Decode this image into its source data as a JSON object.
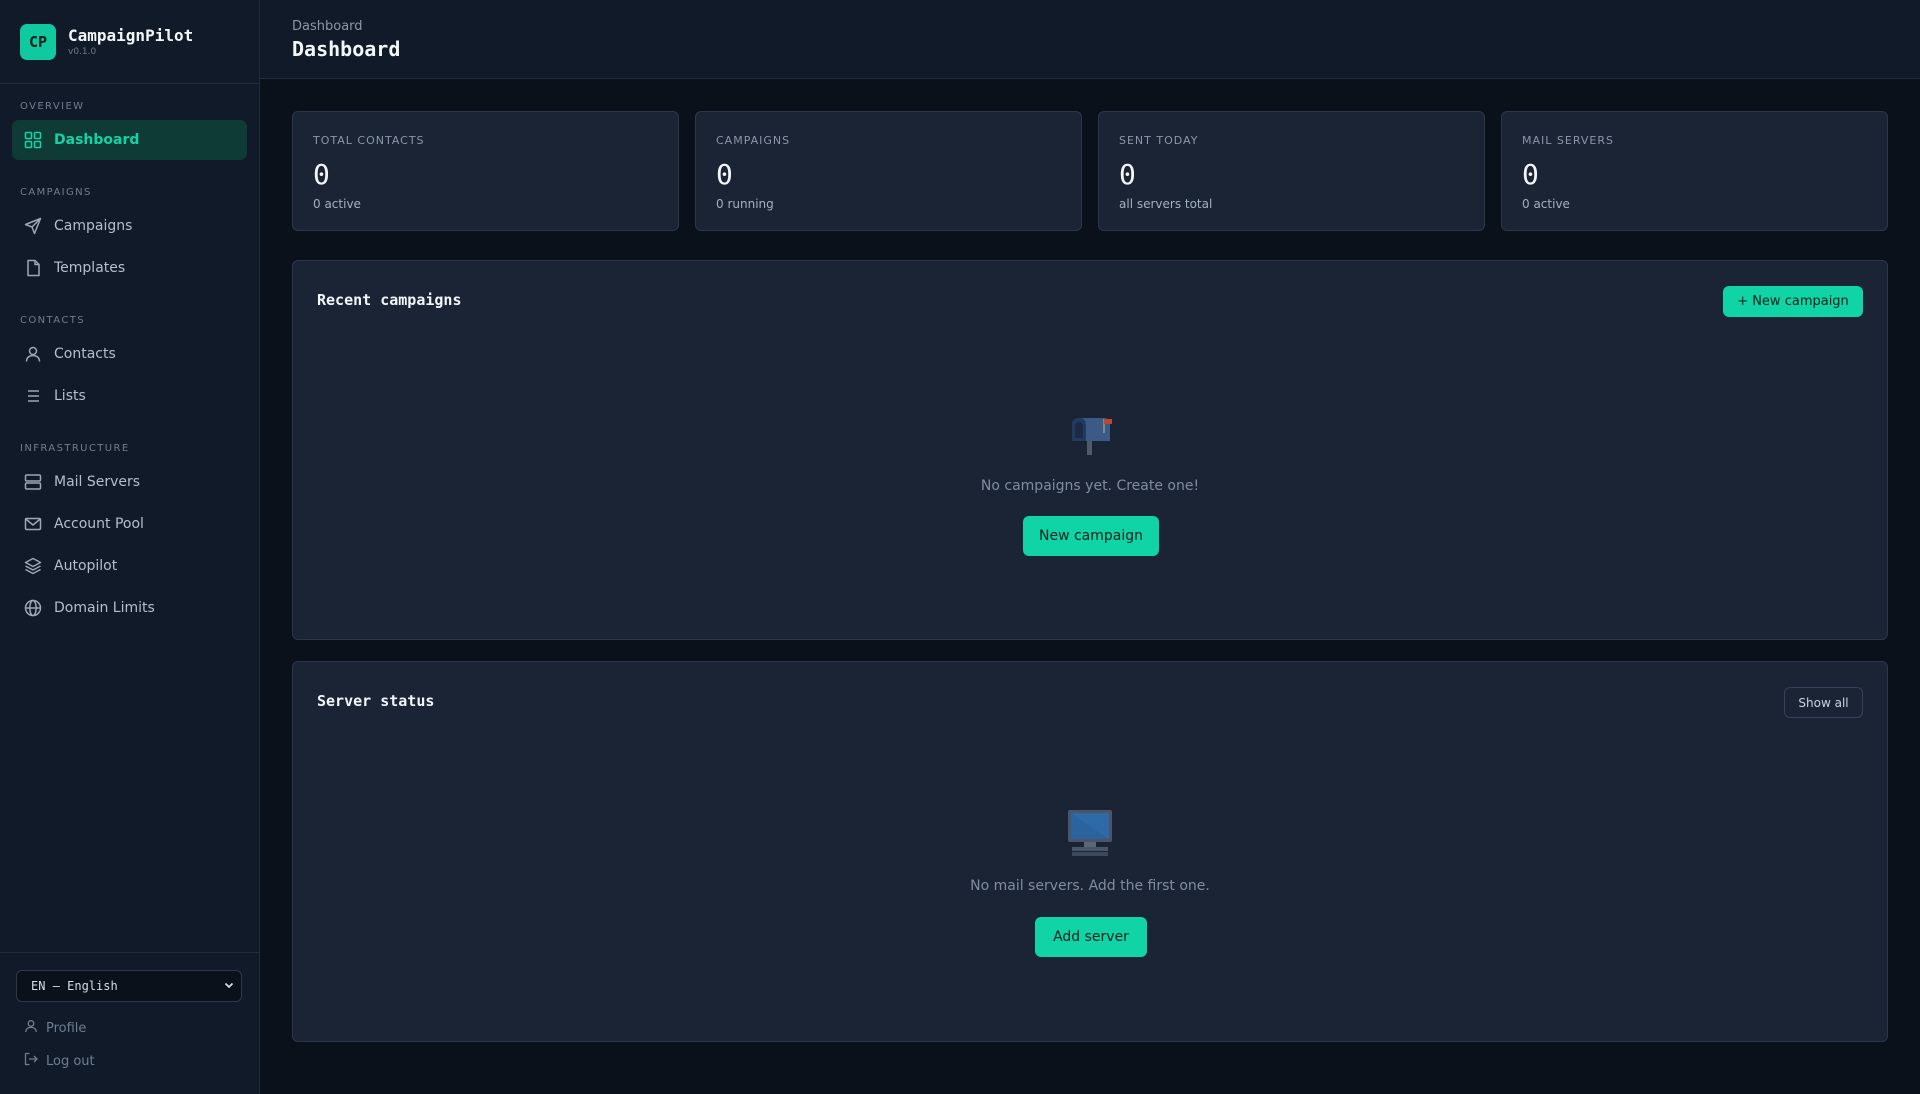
{
  "brand": {
    "logo_text": "CP",
    "name": "CampaignPilot",
    "version": "v0.1.0"
  },
  "sidebar": {
    "sections": [
      {
        "label": "OVERVIEW",
        "items": [
          {
            "label": "Dashboard",
            "icon": "grid-icon",
            "active": true
          }
        ]
      },
      {
        "label": "CAMPAIGNS",
        "items": [
          {
            "label": "Campaigns",
            "icon": "send-icon"
          },
          {
            "label": "Templates",
            "icon": "file-icon"
          }
        ]
      },
      {
        "label": "CONTACTS",
        "items": [
          {
            "label": "Contacts",
            "icon": "user-icon"
          },
          {
            "label": "Lists",
            "icon": "list-icon"
          }
        ]
      },
      {
        "label": "INFRASTRUCTURE",
        "items": [
          {
            "label": "Mail Servers",
            "icon": "server-icon"
          },
          {
            "label": "Account Pool",
            "icon": "mail-icon"
          },
          {
            "label": "Autopilot",
            "icon": "layers-icon"
          },
          {
            "label": "Domain Limits",
            "icon": "globe-icon"
          }
        ]
      }
    ],
    "language": "EN — English",
    "profile_label": "Profile",
    "logout_label": "Log out"
  },
  "header": {
    "breadcrumb": "Dashboard",
    "title": "Dashboard"
  },
  "stats": [
    {
      "label": "TOTAL CONTACTS",
      "value": "0",
      "sub": "0 active"
    },
    {
      "label": "CAMPAIGNS",
      "value": "0",
      "sub": "0 running"
    },
    {
      "label": "SENT TODAY",
      "value": "0",
      "sub": "all servers total"
    },
    {
      "label": "MAIL SERVERS",
      "value": "0",
      "sub": "0 active"
    }
  ],
  "recent_campaigns": {
    "title": "Recent campaigns",
    "new_button": "+  New campaign",
    "empty_icon": "mailbox-icon",
    "empty_text": "No campaigns yet. Create one!",
    "empty_button": "New campaign"
  },
  "server_status": {
    "title": "Server status",
    "show_all": "Show all",
    "empty_icon": "computer-icon",
    "empty_text": "No mail servers. Add the first one.",
    "empty_button": "Add server"
  },
  "colors": {
    "accent": "#10d3a6",
    "background": "#0b111b",
    "panel": "#1a2435",
    "sidebar": "#111a28"
  }
}
